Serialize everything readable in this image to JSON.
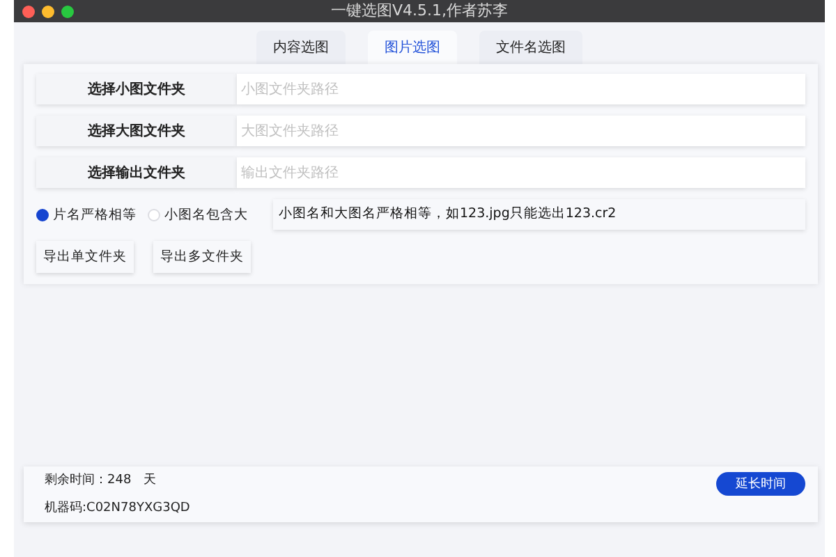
{
  "window": {
    "title": "一键选图V4.5.1,作者苏李"
  },
  "tabs": [
    {
      "label": "内容选图",
      "selected": false
    },
    {
      "label": "图片选图",
      "selected": true
    },
    {
      "label": "文件名选图",
      "selected": false
    }
  ],
  "folders": [
    {
      "button": "选择小图文件夹",
      "placeholder": "小图文件夹路径"
    },
    {
      "button": "选择大图文件夹",
      "placeholder": "大图文件夹路径"
    },
    {
      "button": "选择输出文件夹",
      "placeholder": "输出文件夹路径"
    }
  ],
  "match_modes": [
    {
      "label": "片名严格相等",
      "selected": true
    },
    {
      "label": "小图名包含大",
      "selected": false
    }
  ],
  "match_description": "小图名和大图名严格相等，如123.jpg只能选出123.cr2",
  "export_buttons": [
    "导出单文件夹",
    "导出多文件夹"
  ],
  "status": {
    "remaining_label": "剩余时间：",
    "remaining_value": "248",
    "remaining_unit": "天",
    "machine_code": "机器码:C02N78YXG3QD",
    "extend_button": "延长时间"
  }
}
